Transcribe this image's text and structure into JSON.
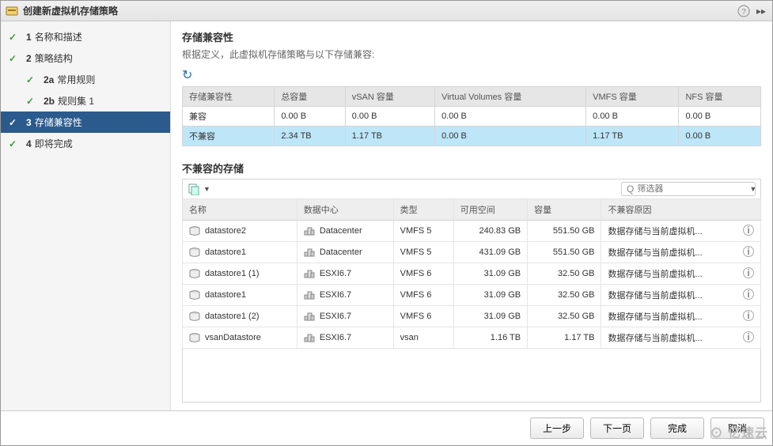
{
  "titlebar": {
    "title": "创建新虚拟机存储策略"
  },
  "steps": [
    {
      "num": "1",
      "label": "名称和描述",
      "checked": true
    },
    {
      "num": "2",
      "label": "策略结构",
      "checked": true
    },
    {
      "num": "2a",
      "label": "常用规则",
      "checked": true,
      "sub": true
    },
    {
      "num": "2b",
      "label": "规则集 1",
      "checked": true,
      "sub": true
    },
    {
      "num": "3",
      "label": "存储兼容性",
      "checked": true,
      "active": true
    },
    {
      "num": "4",
      "label": "即将完成",
      "checked": true
    }
  ],
  "main": {
    "section_title": "存储兼容性",
    "description": "根据定义，此虚拟机存储策略与以下存储兼容:"
  },
  "compat_table": {
    "headers": [
      "存储兼容性",
      "总容量",
      "vSAN 容量",
      "Virtual Volumes 容量",
      "VMFS 容量",
      "NFS 容量"
    ],
    "rows": [
      {
        "cells": [
          "兼容",
          "0.00 B",
          "0.00 B",
          "0.00 B",
          "0.00 B",
          "0.00 B"
        ],
        "selected": false
      },
      {
        "cells": [
          "不兼容",
          "2.34 TB",
          "1.17 TB",
          "0.00 B",
          "1.17 TB",
          "0.00 B"
        ],
        "selected": true
      }
    ]
  },
  "incompat_title": "不兼容的存储",
  "filter": {
    "placeholder": "筛选器"
  },
  "incompat_table": {
    "headers": [
      "名称",
      "数据中心",
      "类型",
      "可用空间",
      "容量",
      "不兼容原因"
    ],
    "rows": [
      {
        "name": "datastore2",
        "dc": "Datacenter",
        "type": "VMFS 5",
        "free": "240.83 GB",
        "cap": "551.50 GB",
        "reason": "数据存储与当前虚拟机..."
      },
      {
        "name": "datastore1",
        "dc": "Datacenter",
        "type": "VMFS 5",
        "free": "431.09 GB",
        "cap": "551.50 GB",
        "reason": "数据存储与当前虚拟机..."
      },
      {
        "name": "datastore1 (1)",
        "dc": "ESXI6.7",
        "type": "VMFS 6",
        "free": "31.09 GB",
        "cap": "32.50 GB",
        "reason": "数据存储与当前虚拟机..."
      },
      {
        "name": "datastore1",
        "dc": "ESXI6.7",
        "type": "VMFS 6",
        "free": "31.09 GB",
        "cap": "32.50 GB",
        "reason": "数据存储与当前虚拟机..."
      },
      {
        "name": "datastore1 (2)",
        "dc": "ESXI6.7",
        "type": "VMFS 6",
        "free": "31.09 GB",
        "cap": "32.50 GB",
        "reason": "数据存储与当前虚拟机..."
      },
      {
        "name": "vsanDatastore",
        "dc": "ESXI6.7",
        "type": "vsan",
        "free": "1.16 TB",
        "cap": "1.17 TB",
        "reason": "数据存储与当前虚拟机..."
      }
    ]
  },
  "buttons": {
    "back": "上一步",
    "next": "下一页",
    "finish": "完成",
    "cancel": "取消"
  },
  "watermark": {
    "brand": "亿速云"
  }
}
